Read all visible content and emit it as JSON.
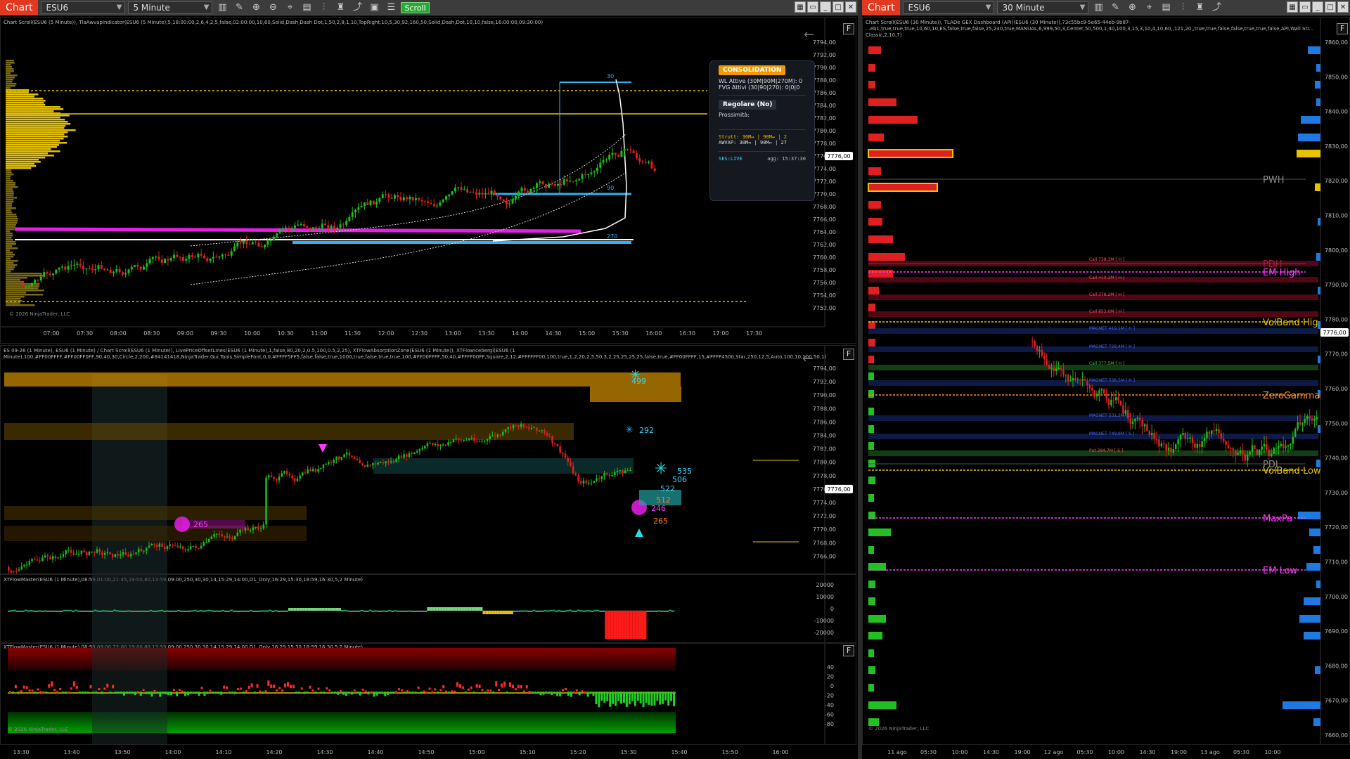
{
  "left_window": {
    "chart_label": "Chart",
    "instrument": "ESU6",
    "interval": "5 Minute",
    "scroll_label": "Scroll",
    "top_pane": {
      "header": "Chart Scroll(ESU6 (5 Minute)), TlaAwvapIndicator(ESU6 (5 Minute),5,18:00:00,2,6,4,2,5,false,02:00:00,10,60,Solid,Dash,Dash Dot,1,50,2,8,1,10,TopRight,10,5,30,92,160,50,Solid,Dash,Dot,10,10,false,16:00:00,09:30:00)",
      "price_labels": [
        "7794,00",
        "7792,00",
        "7790,00",
        "7788,00",
        "7786,00",
        "7784,00",
        "7782,00",
        "7780,00",
        "7778,00",
        "7776,00",
        "7774,00",
        "7772,00",
        "7770,00",
        "7768,00",
        "7766,00",
        "7764,00",
        "7762,00",
        "7760,00",
        "7758,00",
        "7756,00",
        "7754,00",
        "7752,00"
      ],
      "current_price": "7776,00",
      "time_labels": [
        "07:00",
        "07:30",
        "08:00",
        "08:30",
        "09:00",
        "09:30",
        "10:00",
        "10:30",
        "11:00",
        "11:30",
        "12:00",
        "12:30",
        "13:00",
        "13:30",
        "14:00",
        "14:30",
        "15:00",
        "15:30",
        "16:00",
        "16:30",
        "17:00",
        "17:30"
      ],
      "level_labels": {
        "l30": "30",
        "l90": "90",
        "l270": "270"
      },
      "copyright": "© 2026 NinjaTrader, LLC",
      "info": {
        "status": "CONSOLIDATION",
        "wl": "WL Attive (30M|90M|270M): 0",
        "fvg": "FVG Attivi (30|90|270): 0|0|0",
        "regime": "Regolare (No)",
        "prossimita": "Prossimità:",
        "strutt": "Strutt: 30M↔ | 90M↔ | 2",
        "awvap": "AWVAP: 30M↔ | 90M↔ | 27",
        "ses": "SES:LIVE",
        "agg": "agg: 15:37:30"
      }
    },
    "mid_pane": {
      "header_line1": "ES 09-26 (1 Minute), ESU6 (1 Minute) / Chart Scroll(ESU6 (1 Minute)), LivePriceOffsetLines(ESU6 (1 Minute),1,false,80,20,2,0.5,100,0.5,2,25), XTFlowAbsorptionZone(ESU6 (1 Minute)), XTFlowIcebergl(ESU6 (1",
      "header_line2": "Minute),100,#FF00FFFF,#FF00FF0FF,90,40,30,Circle,2,200,#84141418,NinjaTrader.Gui.Tools.SimpleFont,0,0,#FFFF5FF5,false,false,true,1000,true,false,true,true,100,#FF00FFFF,50,40,#FFFF00FF,Square,2,12,#FFFFFF00,100,true,1,2,20,2,5,50,3,2,25,25,25,25,false,true,#FF00FFFF,15,#FFFF4500,Star,250,12,5,Auto,100,10,100,50,1)",
      "price_labels": [
        "7794,00",
        "7792,00",
        "7790,00",
        "7788,00",
        "7786,00",
        "7784,00",
        "7782,00",
        "7780,00",
        "7778,00",
        "7776,00",
        "7774,00",
        "7772,00",
        "7770,00",
        "7768,00",
        "7766,00"
      ],
      "current_price": "7776,00",
      "marker_labels": {
        "m499": "499",
        "m292": "292",
        "m535": "535",
        "m506": "506",
        "m522": "522",
        "m512": "512",
        "m246": "246",
        "m265a": "265",
        "m265b": "265"
      }
    },
    "flow_pane": {
      "header": "XTFlowMaster(ESU6 (1 Minute),08:59,01:00,21:45,19:00,80,13:59,09:00,250,30,30,14,15:29,14:00,D1_Only,16:29,15:30,18:59,16:30,5,2 Minute)",
      "labels": [
        "20000",
        "10000",
        "0",
        "-10000",
        "-20000"
      ]
    },
    "flow_pane2": {
      "header": "XTFlowMaster(ESU6 (1 Minute),08:59,09:00,22:00,19:00,80,13:59,09:00,250,30,30,14,15:29,14:00,D1_Only,16:29,15:30,18:59,16:30,5,2 Minute)",
      "labels": [
        "40",
        "20",
        "0",
        "-20",
        "-40",
        "-60",
        "-80"
      ],
      "copyright": "© 2026 NinjaTrader, LLC"
    },
    "bottom_time_labels": [
      "13:30",
      "13:40",
      "13:50",
      "14:00",
      "14:10",
      "14:20",
      "14:30",
      "14:40",
      "14:50",
      "15:00",
      "15:10",
      "15:20",
      "15:30",
      "15:40",
      "15:50",
      "16:00"
    ]
  },
  "right_window": {
    "chart_label": "Chart",
    "instrument": "ESU6",
    "interval": "30 Minute",
    "header_line1": "Chart Scroll(ESU6 (30 Minute)), TLADe GEX Dashboard (API)(ESU6 (30 Minute)),73c55bc9-5e65-44eb-9b87-",
    "header_line2": "...eb1,true,true,true,10,60,10,ES,false,true,false,25,240,true,MANUAL,6,999,50,3,Center,50,500,1,40,100,3,15,3,10,4,10,60,,121,20,,true,true,false,false,true,true,false,API,Wall Str...",
    "header_line3": "Classic,2,10,7)",
    "price_labels": [
      "7860,00",
      "7850,00",
      "7840,00",
      "7830,00",
      "7820,00",
      "7810,00",
      "7800,00",
      "7790,00",
      "7780,00",
      "7770,00",
      "7760,00",
      "7750,00",
      "7740,00",
      "7730,00",
      "7720,00",
      "7710,00",
      "7700,00",
      "7690,00",
      "7680,00",
      "7670,00",
      "7660,00"
    ],
    "current_price": "7776,00",
    "levels": {
      "pwh": "PWH",
      "pdh": "PDH",
      "em_high": "EM High",
      "volband_high": "VolBand Hig",
      "zero_gamma": "ZeroGamma",
      "pdl": "PDL",
      "volband_low": "VolBand Low",
      "maxpain": "MaxPa",
      "em_low": "EM Low"
    },
    "gex_labels": [
      "Call 738,3M [ H ]",
      "Call 410,3M [ H ]",
      "Call 378,2M [ H ]",
      "Call 853,0M [ H ]",
      "MAGNET 419,1M [ H ]",
      "MAGNET 729,4M [ H ]",
      "Call 377,5M [ H ]",
      "MAGNET 338,5M [ H ]",
      "MAGNET 531,2M [ S ]",
      "MAGNET 749,9M [ S ]",
      "Put 284,7M [ S ]"
    ],
    "time_labels": [
      "11 ago",
      "05:30",
      "10:00",
      "14:30",
      "19:00",
      "12 ago",
      "05:30",
      "10:00",
      "14:30",
      "19:00",
      "13 ago",
      "05:30",
      "10:00"
    ],
    "copyright": "© 2026 NinjaTrader, LLC"
  },
  "colors": {
    "accent_red": "#e0391f",
    "green": "#2fa53a",
    "gold": "#e6c200",
    "cyan": "#27b6f0",
    "magenta": "#e81ee8"
  }
}
